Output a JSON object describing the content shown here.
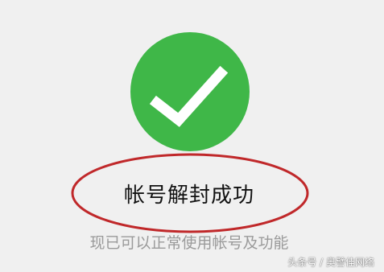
{
  "status": {
    "icon": "checkmark-icon",
    "title": "帐号解封成功",
    "message": "现已可以正常使用帐号及功能"
  },
  "watermark": {
    "text": "头条号 / 奥譬佳网络"
  },
  "colors": {
    "success_green": "#3fb748",
    "annotation_red": "#c0282a",
    "background": "#f0f0f0",
    "message_gray": "#9a9a9a"
  }
}
